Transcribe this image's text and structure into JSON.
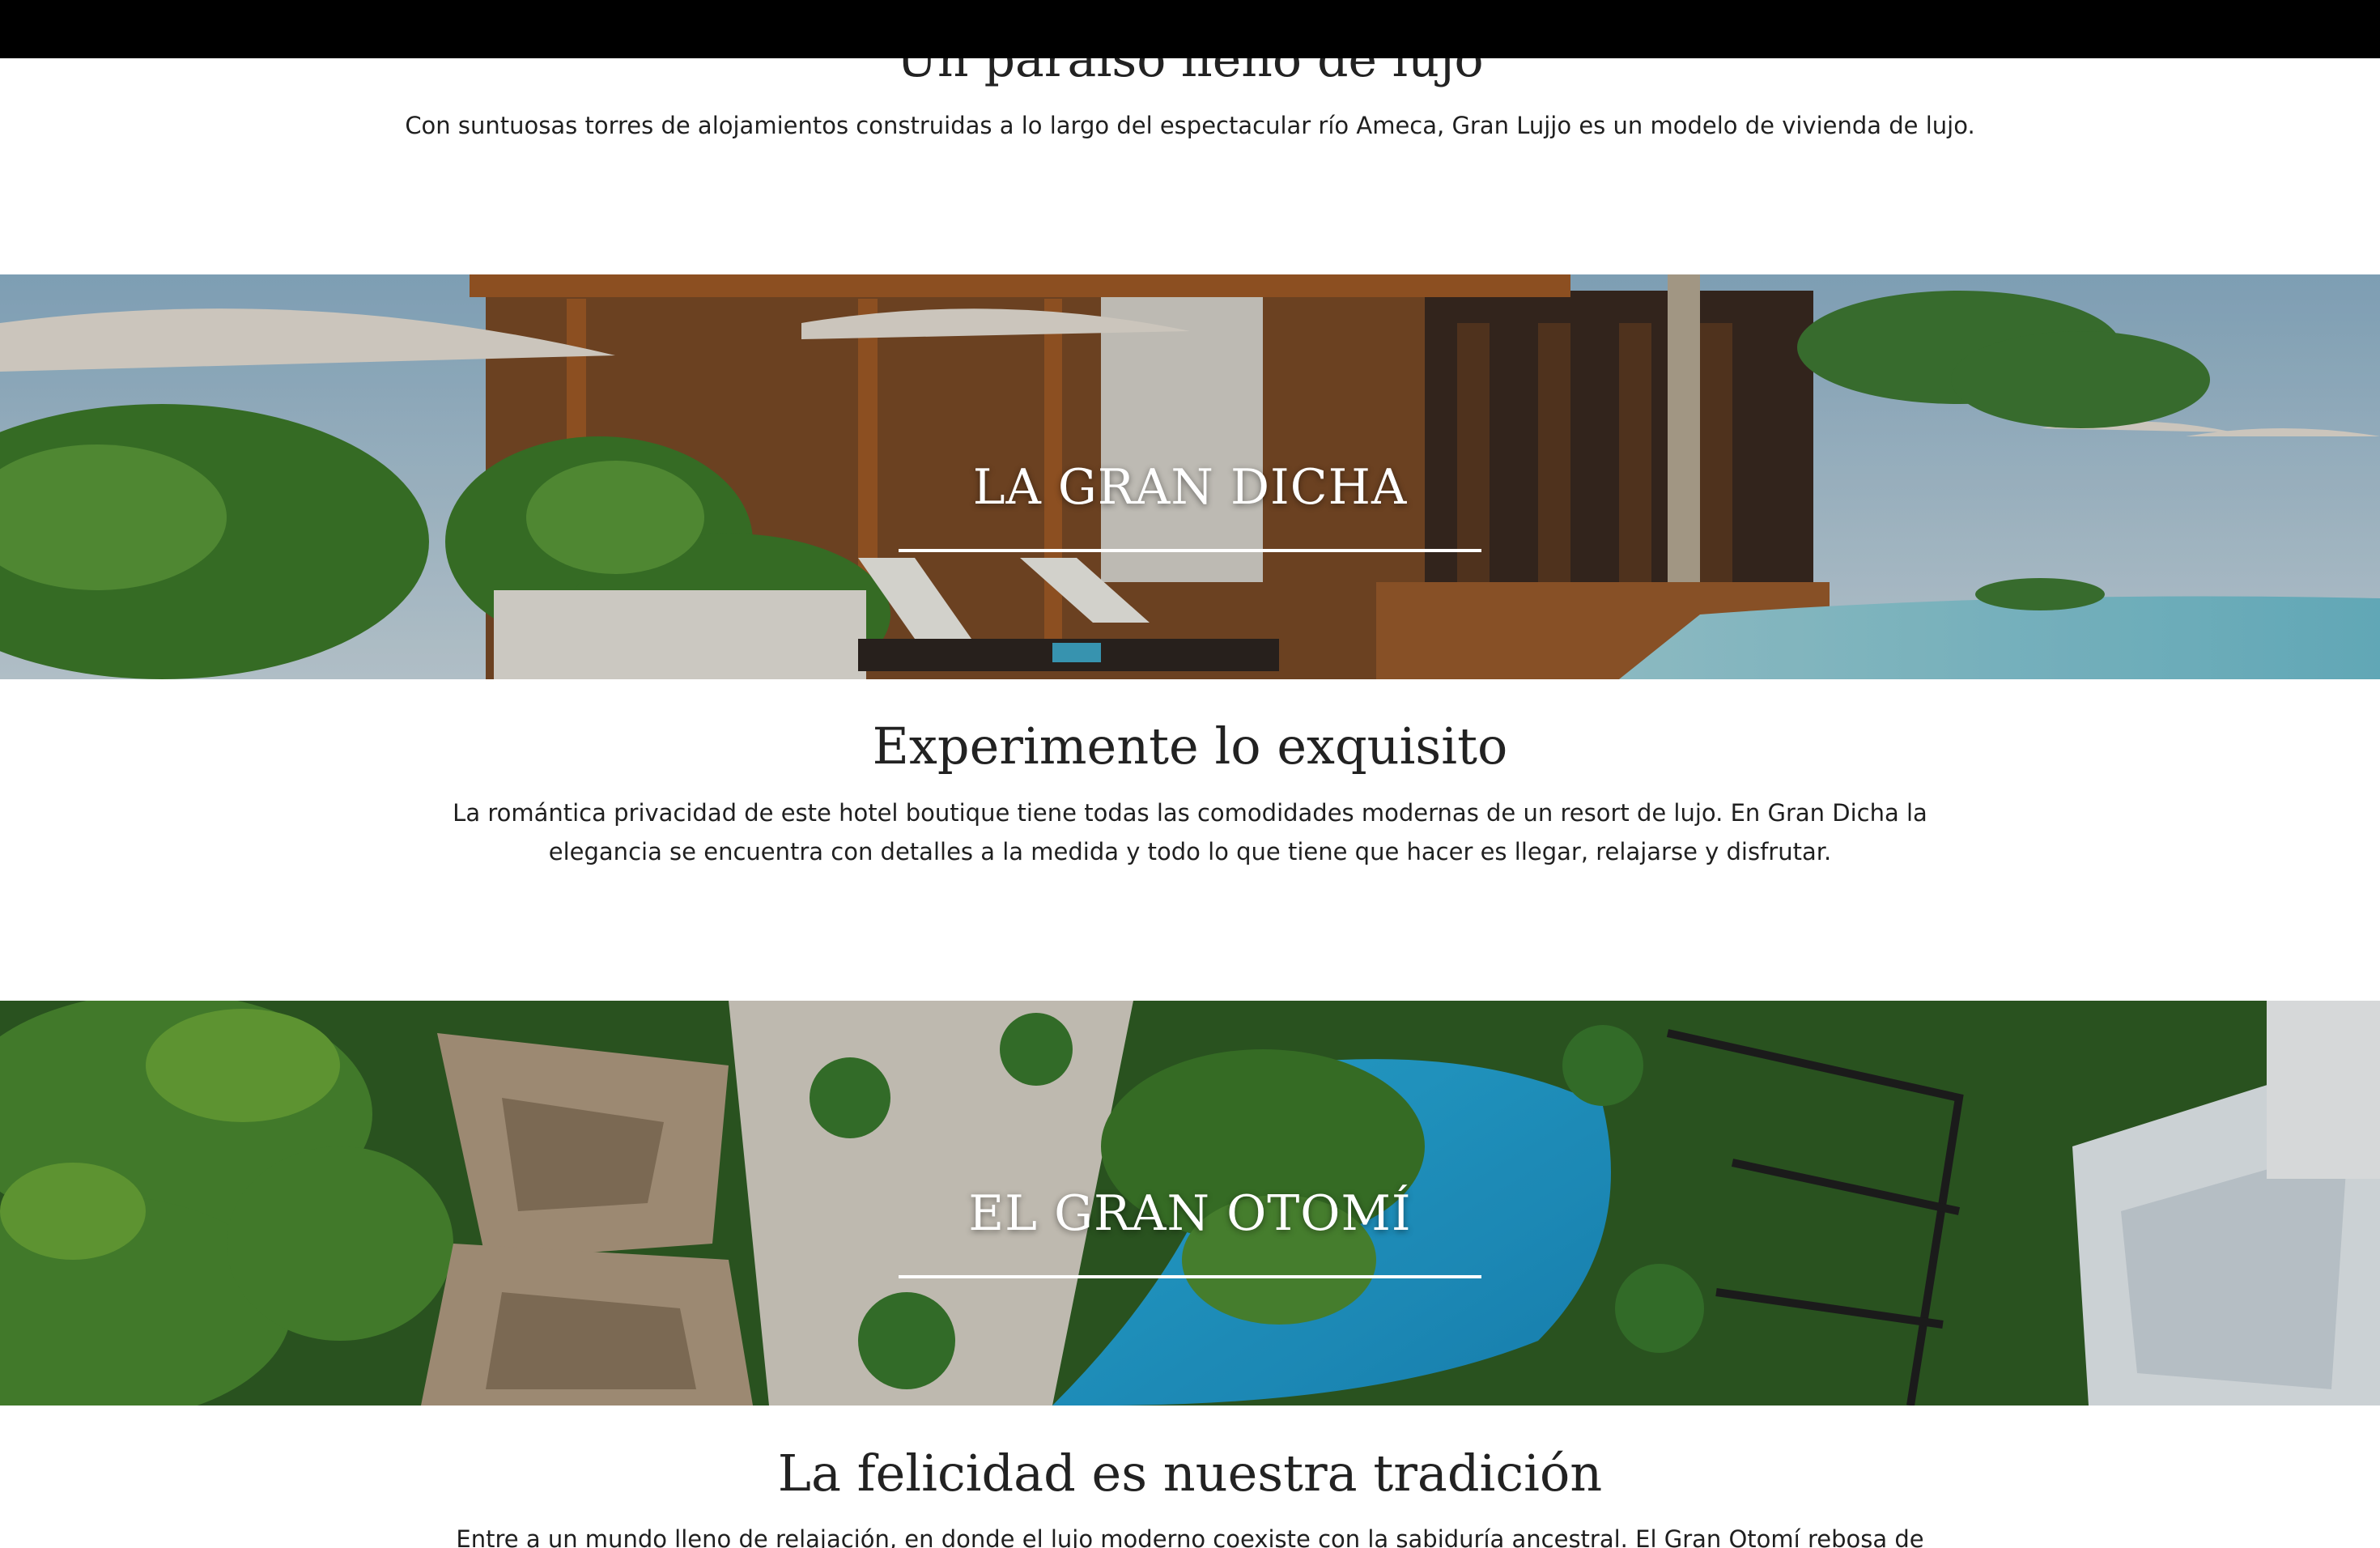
{
  "intro": {
    "heading": "Un paraíso lleno de lujo",
    "text": "Con suntuosas torres de alojamientos construidas a lo largo del espectacular río Ameca, Gran Lujjo es un modelo de vivienda de lujo."
  },
  "sections": [
    {
      "hero_title": "LA GRAN DICHA",
      "heading": "Experimente lo exquisito",
      "text_lines": [
        "La romántica privacidad de este hotel boutique tiene todas las comodidades modernas de un resort de lujo. En Gran Dicha la",
        "elegancia se encuentra con detalles a la medida y todo lo que tiene que hacer es llegar, relajarse y disfrutar."
      ]
    },
    {
      "hero_title": "EL GRAN OTOMÍ",
      "heading": "La felicidad es nuestra tradición",
      "text_lines": [
        "Entre a un mundo lleno de relajación, en donde el lujo moderno coexiste con la sabiduría ancestral. El Gran Otomí rebosa de"
      ]
    }
  ],
  "colors": {
    "top_bar": "#000000",
    "text": "#222222",
    "pool_blue": "#1fa3d8",
    "foliage": "#3d7a2a",
    "wood": "#8a4e22"
  }
}
